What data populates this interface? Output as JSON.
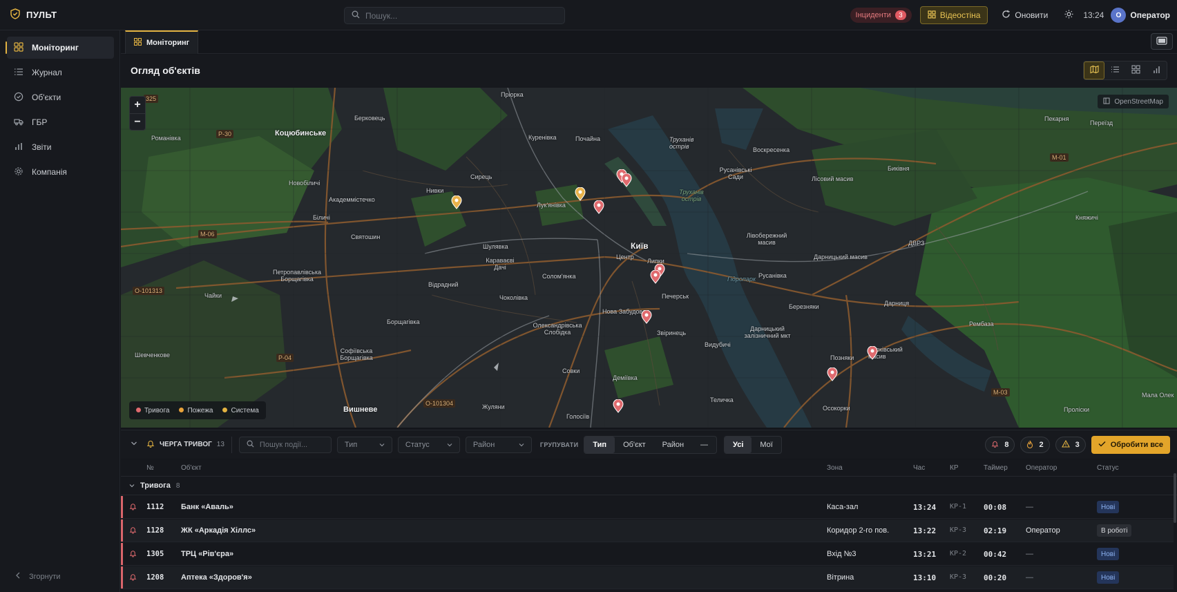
{
  "app": {
    "name": "ПУЛЬТ"
  },
  "header": {
    "search_placeholder": "Пошук...",
    "incidents_label": "Інциденти",
    "incidents_count": "3",
    "videowall_label": "Відеостіна",
    "refresh_label": "Оновити",
    "time": "13:24",
    "avatar_letter": "О",
    "user_name": "Оператор"
  },
  "sidebar": {
    "items": [
      {
        "label": "Моніторинг",
        "icon": "grid-icon"
      },
      {
        "label": "Журнал",
        "icon": "list-icon"
      },
      {
        "label": "Об'єкти",
        "icon": "shield-check-icon"
      },
      {
        "label": "ГБР",
        "icon": "truck-icon"
      },
      {
        "label": "Звіти",
        "icon": "bar-chart-icon"
      },
      {
        "label": "Компанія",
        "icon": "gear-icon"
      }
    ],
    "collapse_label": "Згорнути"
  },
  "tabs": {
    "active": "Моніторинг"
  },
  "panel": {
    "title": "Огляд об'єктів"
  },
  "map": {
    "attribution": "OpenStreetMap",
    "legend": [
      {
        "label": "Тривога",
        "color": "#e06a6e"
      },
      {
        "label": "Пожежа",
        "color": "#e8a23a"
      },
      {
        "label": "Система",
        "color": "#e3b341"
      }
    ],
    "labels": {
      "kyiv": "Київ",
      "priorka": "Пріорка",
      "berkovets": "Берковець",
      "kotsiubynske": "Коцюбинське",
      "romanivka": "Романівка",
      "kurenivka": "Куренівка",
      "pochaina": "Почайна",
      "trukhaniv": "Труханів острів",
      "voskresenka": "Воскресенка",
      "rusanivski_sady": "Русанівські Сади",
      "lisovyi": "Лісовий масив",
      "bykivnia": "Биківня",
      "novobilychi": "Новобіличі",
      "syrets": "Сирець",
      "nyvky": "Нивки",
      "akadem": "Академмістечко",
      "lukianivka": "Лук'янівка",
      "bilychi": "Біличі",
      "sviatoshyn": "Святошин",
      "shuliavka": "Шулявка",
      "tsentr": "Центр",
      "lypky": "Липки",
      "livoberezhnyi": "Лівобережний масив",
      "darnytskyi_masyv": "Дарницький масив",
      "dvrz": "ДВРЗ",
      "karavaievi": "Караваєві Дачі",
      "vidradnyi": "Відрадний",
      "solomianka": "Солом'янка",
      "rusanivka": "Русанівка",
      "pecherska": "Печерськ",
      "petropavlivska": "Петропавлівська Борщагівка",
      "chaiky": "Чайки",
      "chokolivka": "Чоколівка",
      "nova_zabudova": "Нова Забудова",
      "berezniaky": "Березняки",
      "darnytsia": "Дарниця",
      "rembaza": "Рембаза",
      "borshchahivka": "Борщагівка",
      "oleksandrivska": "Олександрівська Слобідка",
      "zvirynets": "Звіринець",
      "vydubychi": "Видубичі",
      "darnytskyi_zavod": "Дарницький залізничний мкт",
      "pozniaky": "Позняки",
      "kharkivskyi": "Харківський масив",
      "shevchenkove": "Шевченкове",
      "sofiivska": "Софіївська Борщагівка",
      "sovky": "Совки",
      "demiivka": "Деміївка",
      "vyshneve": "Вишневе",
      "zhuliany": "Жуляни",
      "holosiiv": "Голосіїв",
      "telychka": "Теличка",
      "osokorky": "Осокорки",
      "prolisky": "Проліски",
      "mala_olek": "Мала Олек",
      "pekharia": "Пекарня",
      "perezid": "Переїзд",
      "knyazhychi": "Княжичі",
      "hidropark": "Гідропарк",
      "trukhaniv_island": "Труханів острів"
    },
    "roads": [
      "325",
      "P-30",
      "M-06",
      "O-101313",
      "P-04",
      "O-101304",
      "M-01",
      "M-03"
    ]
  },
  "queue": {
    "title": "ЧЕРГА ТРИВОГ",
    "count": "13",
    "search_placeholder": "Пошук події...",
    "filters": [
      "Тип",
      "Статус",
      "Район"
    ],
    "group_label": "ГРУПУВАТИ",
    "group_options": [
      "Тип",
      "Об'єкт",
      "Район",
      "—"
    ],
    "scope_options": [
      "Усі",
      "Мої"
    ],
    "counters": {
      "alarm": "8",
      "fire": "2",
      "warning": "3"
    },
    "process_all": "Обробити все",
    "columns": {
      "no": "№",
      "object": "Об'єкт",
      "zone": "Зона",
      "time": "Час",
      "kp": "КР",
      "timer": "Таймер",
      "operator": "Оператор",
      "status": "Статус"
    },
    "group": {
      "name": "Тривога",
      "count": "8"
    },
    "rows": [
      {
        "no": "1112",
        "object": "Банк «Аваль»",
        "zone": "Каса-зал",
        "time": "13:24",
        "kp": "КР-1",
        "timer": "00:08",
        "operator": "—",
        "status": "Нові"
      },
      {
        "no": "1128",
        "object": "ЖК «Аркадія Хіллс»",
        "zone": "Коридор 2-го пов.",
        "time": "13:22",
        "kp": "КР-3",
        "timer": "02:19",
        "operator": "Оператор",
        "status": "В роботі"
      },
      {
        "no": "1305",
        "object": "ТРЦ «Рів'єра»",
        "zone": "Вхід №3",
        "time": "13:21",
        "kp": "КР-2",
        "timer": "00:42",
        "operator": "—",
        "status": "Нові"
      },
      {
        "no": "1208",
        "object": "Аптека «Здоров'я»",
        "zone": "Вітрина",
        "time": "13:10",
        "kp": "КР-3",
        "timer": "00:20",
        "operator": "—",
        "status": "Нові"
      }
    ]
  }
}
